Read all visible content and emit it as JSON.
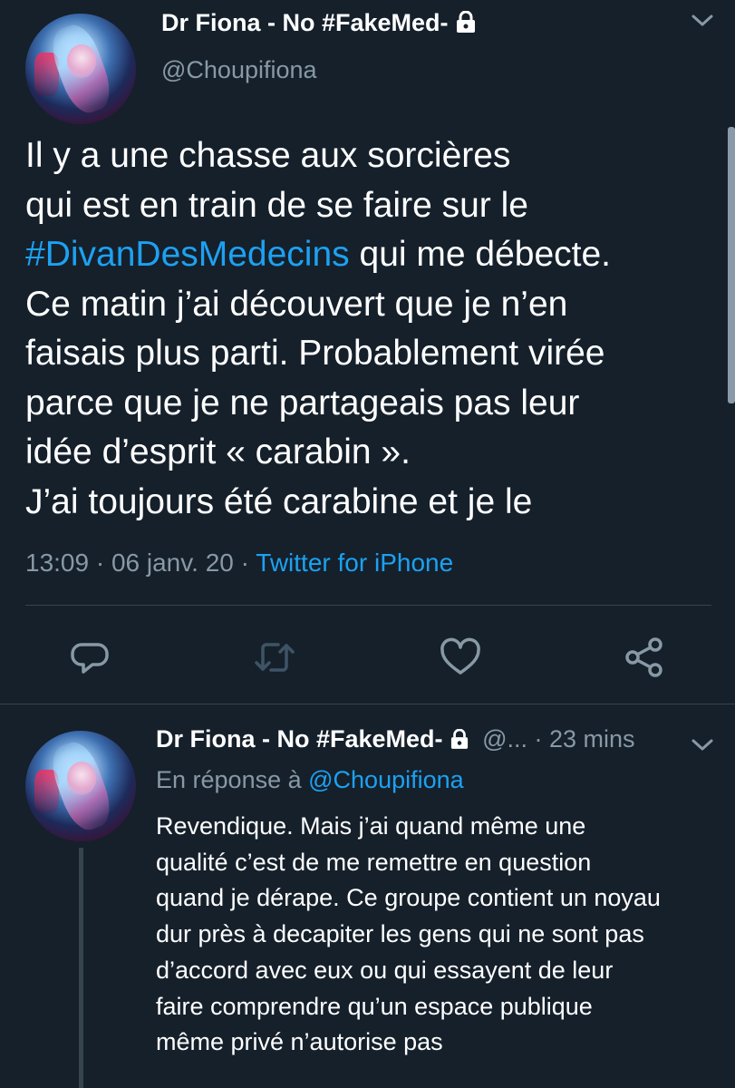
{
  "main_tweet": {
    "display_name": "Dr Fiona - No #FakeMed-",
    "handle": "@Choupifiona",
    "text_lines": [
      {
        "before": "Il y a une chasse aux sorcières",
        "hashtag": "",
        "after": ""
      },
      {
        "before": "qui est en train de se faire sur le",
        "hashtag": "",
        "after": ""
      },
      {
        "before": "",
        "hashtag": "#DivanDesMedecins",
        "after": " qui me débecte."
      },
      {
        "before": "Ce matin j’ai découvert que je n’en",
        "hashtag": "",
        "after": ""
      },
      {
        "before": "faisais plus parti. Probablement virée",
        "hashtag": "",
        "after": ""
      },
      {
        "before": "parce que je ne partageais pas leur",
        "hashtag": "",
        "after": ""
      },
      {
        "before": "idée d’esprit « carabin ».",
        "hashtag": "",
        "after": ""
      },
      {
        "before": "J’ai toujours été carabine et je le",
        "hashtag": "",
        "after": ""
      }
    ],
    "time": "13:09",
    "separator1": " · ",
    "date": "06 janv. 20",
    "separator2": " · ",
    "source": "Twitter for iPhone"
  },
  "actions": {
    "reply_icon": "reply-icon",
    "retweet_icon": "retweet-icon",
    "like_icon": "heart-icon",
    "share_icon": "share-icon"
  },
  "reply_tweet": {
    "display_name": "Dr Fiona - No #FakeMed-",
    "handle_truncated": "@...",
    "separator": " · ",
    "time_ago": "23 mins",
    "in_reply_prefix": "En réponse à ",
    "in_reply_mention": "@Choupifiona",
    "text_lines": [
      "Revendique. Mais j’ai quand même une",
      "qualité c’est de me remettre en question",
      "quand je dérape. Ce groupe contient un noyau",
      "dur près à decapiter les gens qui ne sont pas",
      "d’accord avec eux ou qui essayent de leur",
      "faire comprendre qu’un espace publique",
      "même privé n’autorise pas"
    ]
  },
  "colors": {
    "background": "#15202b",
    "text": "#ffffff",
    "muted": "#8899a6",
    "accent": "#1da1f2",
    "divider": "#38444d"
  }
}
